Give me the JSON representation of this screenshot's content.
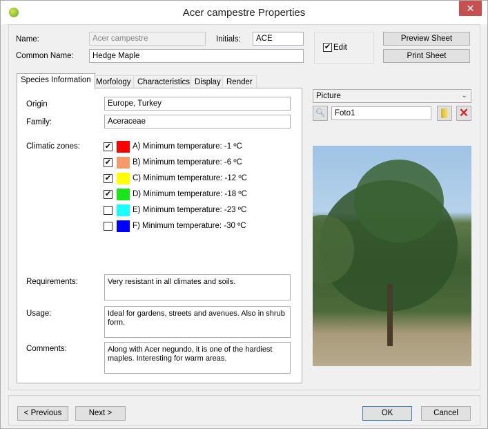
{
  "window": {
    "title": "Acer campestre Properties",
    "close_label": "✕"
  },
  "header": {
    "name_label": "Name:",
    "name_value": "Acer campestre",
    "initials_label": "Initials:",
    "initials_value": "ACE",
    "common_label": "Common Name:",
    "common_value": "Hedge Maple",
    "edit_label": "Edit",
    "edit_checked": true,
    "preview_label": "Preview Sheet",
    "print_label": "Print Sheet"
  },
  "tabs": [
    {
      "label": "Species Information",
      "active": true
    },
    {
      "label": "Morfology"
    },
    {
      "label": "Characteristics"
    },
    {
      "label": "Display"
    },
    {
      "label": "Render"
    }
  ],
  "species": {
    "origin_label": "Origin",
    "origin_value": "Europe, Turkey",
    "family_label": "Family:",
    "family_value": "Aceraceae",
    "zones_label": "Climatic zones:",
    "zones": [
      {
        "label": "A) Minimum temperature: -1 ºC",
        "color": "#ff0000",
        "checked": true
      },
      {
        "label": "B) Minimum temperature: -6 ºC",
        "color": "#f79a6a",
        "checked": true
      },
      {
        "label": "C) Minimum temperature: -12 ºC",
        "color": "#ffff00",
        "checked": true
      },
      {
        "label": "D) Minimum temperature: -18 ºC",
        "color": "#19e619",
        "checked": true
      },
      {
        "label": "E) Minimum temperature: -23 ºC",
        "color": "#19ffff",
        "checked": false
      },
      {
        "label": "F) Minimum temperature: -30 ºC",
        "color": "#0000ff",
        "checked": false
      }
    ],
    "requirements_label": "Requirements:",
    "requirements_value": "Very resistant in all climates and soils.",
    "usage_label": "Usage:",
    "usage_value": "Ideal for gardens, streets and avenues. Also in shrub form.",
    "comments_label": "Comments:",
    "comments_value": "Along with Acer negundo, it is one of the hardiest maples. Interesting for warm areas."
  },
  "picture": {
    "dropdown_value": "Picture",
    "file_value": "Foto1"
  },
  "footer": {
    "previous_label": "< Previous",
    "next_label": "Next >",
    "ok_label": "OK",
    "cancel_label": "Cancel"
  }
}
